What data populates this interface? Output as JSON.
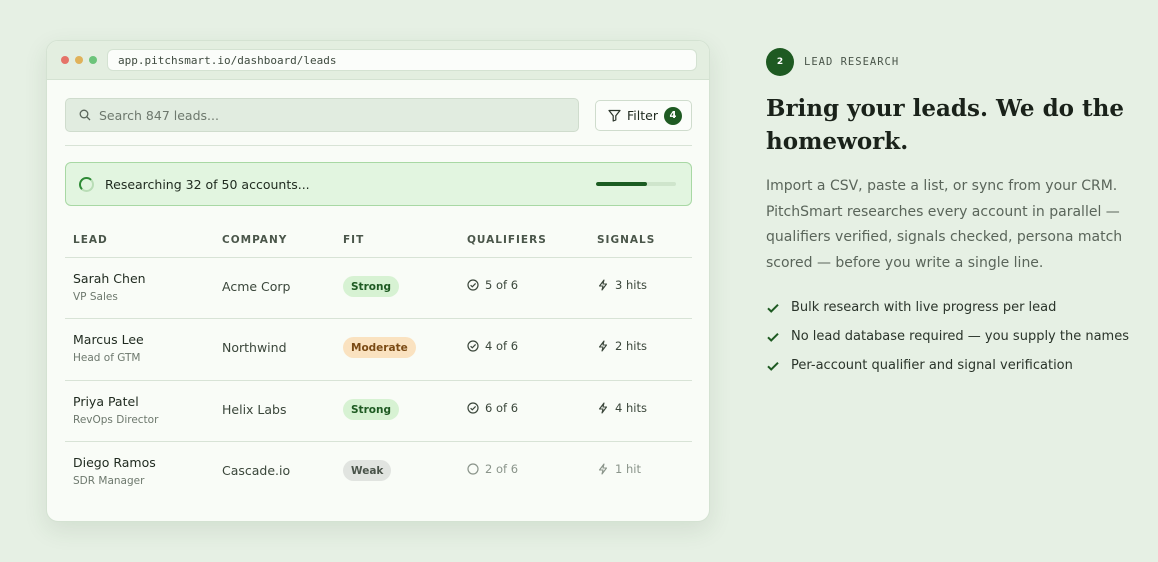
{
  "browser": {
    "url": "app.pitchsmart.io/dashboard/leads"
  },
  "search": {
    "placeholder": "Search 847 leads..."
  },
  "filter": {
    "label": "Filter",
    "count": "4"
  },
  "progress": {
    "text": "Researching 32 of 50 accounts...",
    "done": 32,
    "total": 50
  },
  "table": {
    "headers": {
      "lead": "LEAD",
      "company": "COMPANY",
      "fit": "FIT",
      "qualifiers": "QUALIFIERS",
      "signals": "SIGNALS"
    },
    "rows": [
      {
        "name": "Sarah Chen",
        "role": "VP Sales",
        "company": "Acme Corp",
        "fit": "Strong",
        "qualifiers": "5 of 6",
        "signals": "3 hits"
      },
      {
        "name": "Marcus Lee",
        "role": "Head of GTM",
        "company": "Northwind",
        "fit": "Moderate",
        "qualifiers": "4 of 6",
        "signals": "2 hits"
      },
      {
        "name": "Priya Patel",
        "role": "RevOps Director",
        "company": "Helix Labs",
        "fit": "Strong",
        "qualifiers": "6 of 6",
        "signals": "4 hits"
      },
      {
        "name": "Diego Ramos",
        "role": "SDR Manager",
        "company": "Cascade.io",
        "fit": "Weak",
        "qualifiers": "2 of 6",
        "signals": "1 hit"
      }
    ]
  },
  "feature": {
    "step": "2",
    "label": "LEAD RESEARCH",
    "headline": "Bring your leads. We do the homework.",
    "description": "Import a CSV, paste a list, or sync from your CRM. PitchSmart researches every account in parallel — qualifiers verified, signals checked, persona match scored — before you write a single line.",
    "bullets": [
      "Bulk research with live progress per lead",
      "No lead database required — you supply the names",
      "Per-account qualifier and signal verification"
    ]
  },
  "colors": {
    "accent": "#1e5a22",
    "background": "#e6f0e4",
    "strong": "#d7f2d3",
    "moderate": "#fae2c0",
    "weak": "#e1e4e0"
  },
  "icons": [
    "search-icon",
    "filter-icon",
    "spinner-icon",
    "check-circle-icon",
    "empty-circle-icon",
    "lightning-icon",
    "checkmark-icon"
  ]
}
